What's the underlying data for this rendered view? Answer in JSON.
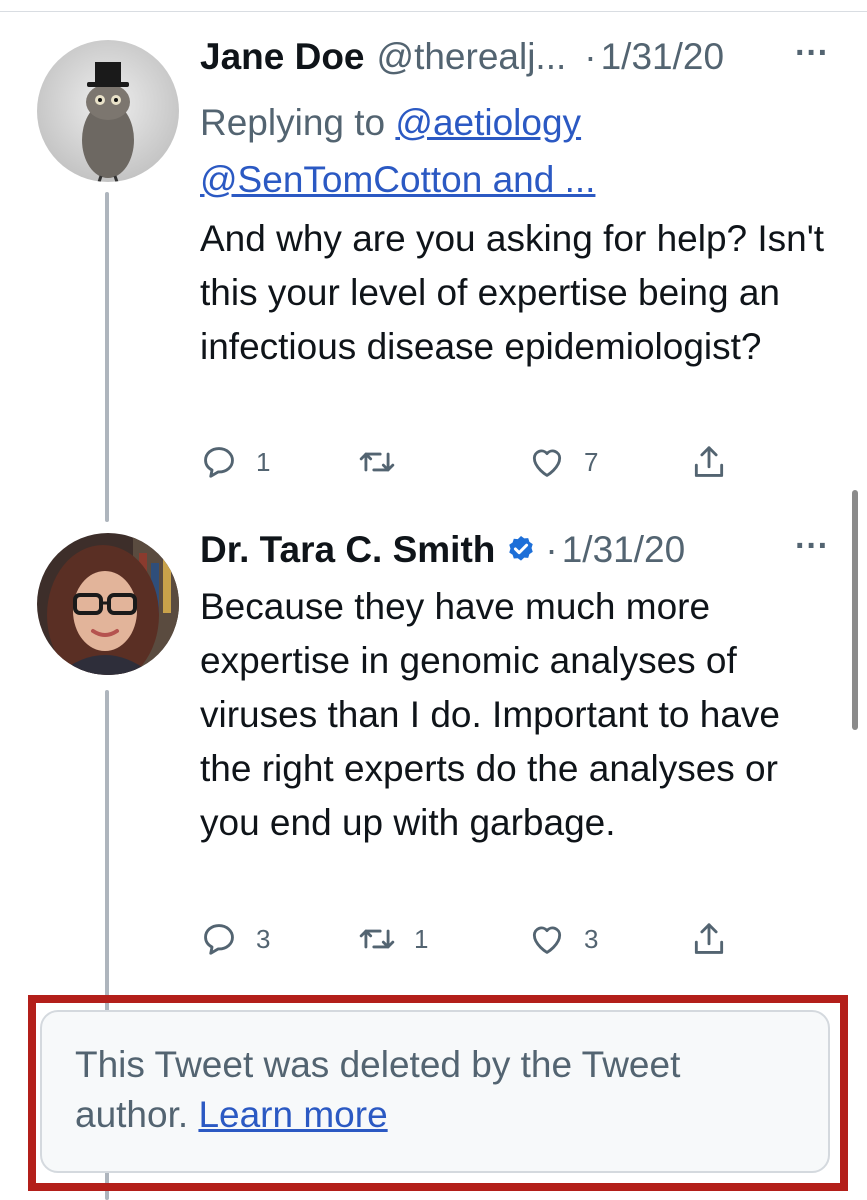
{
  "tweets": [
    {
      "name": "Jane Doe",
      "handle": "@therealj...",
      "dot": "·",
      "date": "1/31/20",
      "more": "···",
      "reply_prefix": "Replying to",
      "reply_handle_1": "@aetiology",
      "reply_handle_2": "@SenTomCotton and ...",
      "text": "And why are you asking for help? Isn't this your level of expertise being an infectious disease epidemiologist?",
      "replies": "1",
      "retweets": "",
      "likes": "7"
    },
    {
      "name": "Dr. Tara C. Smith",
      "verified": true,
      "dot": "·",
      "date": "1/31/20",
      "more": "···",
      "text": "Because they have much more expertise in genomic analyses of viruses than I do. Important to have the right experts do the analyses or you end up with garbage.",
      "replies": "3",
      "retweets": "1",
      "likes": "3"
    }
  ],
  "deleted_notice": {
    "text": "This Tweet was deleted by the Tweet author.",
    "link": "Learn more"
  },
  "colors": {
    "link": "#2b59c3",
    "secondary_text": "#536471",
    "verified": "#1d6fd8",
    "highlight_frame": "#b31f1a"
  },
  "icons": [
    "reply-icon",
    "retweet-icon",
    "like-icon",
    "share-icon",
    "verified-badge-icon",
    "more-icon"
  ]
}
